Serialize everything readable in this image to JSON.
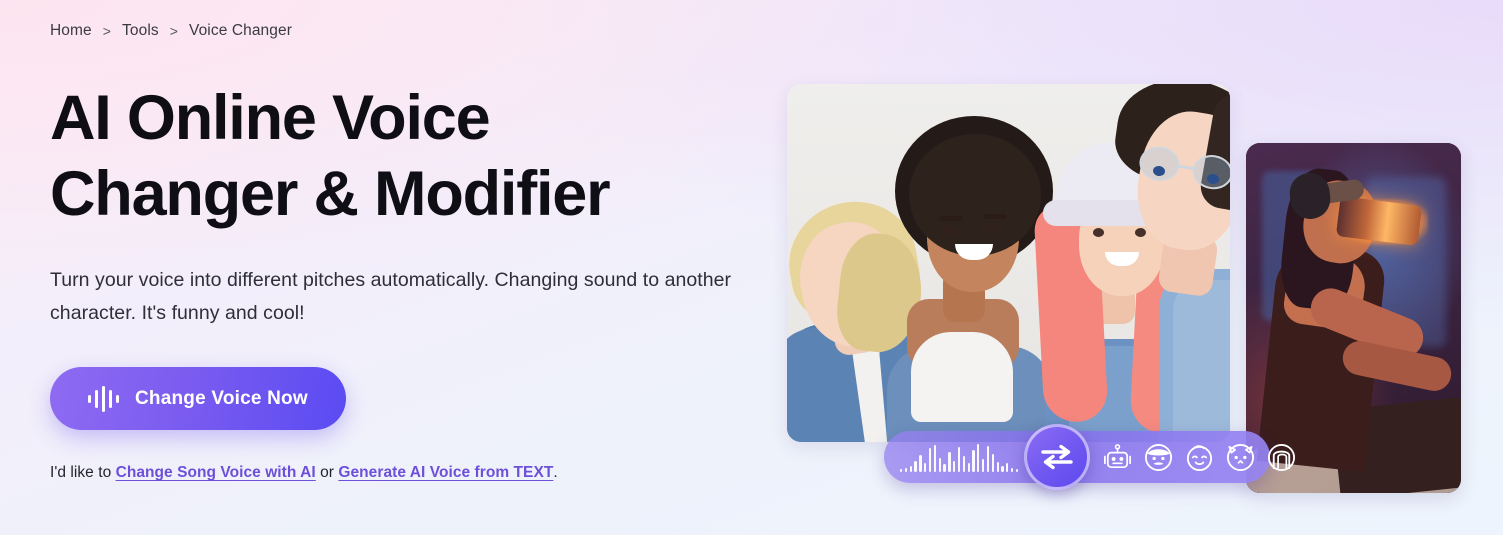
{
  "breadcrumb": {
    "items": [
      {
        "label": "Home"
      },
      {
        "label": "Tools"
      },
      {
        "label": "Voice Changer"
      }
    ],
    "separator": ">"
  },
  "hero": {
    "headline_line1": "AI Online Voice",
    "headline_line2": "Changer & Modifier",
    "subtitle": "Turn your voice into different pitches automatically. Changing sound to another character. It's funny and cool!",
    "cta_label": "Change Voice Now",
    "cta_icon": "waveform-icon",
    "note_prefix": "I'd like to ",
    "note_link_1": "Change Song Voice with AI",
    "note_middle": " or ",
    "note_link_2": "Generate AI Voice from TEXT",
    "note_suffix": "."
  },
  "media": {
    "main_photo_alt": "Four smiling young people posing together",
    "vr_photo_alt": "Woman wearing a glowing VR headset in a dark neon room"
  },
  "toolbar": {
    "swap_icon": "swap-arrows-icon",
    "waveform_icon": "audio-waveform-icon",
    "voices": [
      {
        "name": "robot-voice-icon",
        "label": "Robot"
      },
      {
        "name": "man-voice-icon",
        "label": "Man"
      },
      {
        "name": "baby-voice-icon",
        "label": "Baby"
      },
      {
        "name": "cat-voice-icon",
        "label": "Cat"
      },
      {
        "name": "woman-voice-icon",
        "label": "Woman"
      }
    ]
  },
  "colors": {
    "accent_purple": "#6d4fd8",
    "cta_gradient_start": "#8f6bf2",
    "cta_gradient_end": "#5a4bf2",
    "heading_text": "#0e0e14",
    "bg_pink": "#fbeef5",
    "bg_lavender": "#f3eefb",
    "bg_blue": "#edf4fd"
  }
}
